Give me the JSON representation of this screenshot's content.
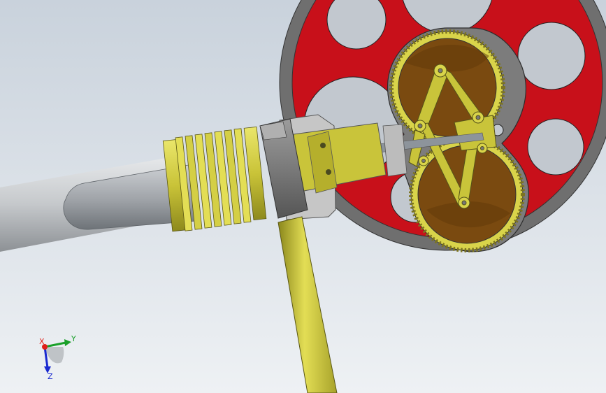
{
  "viewport": {
    "background_top": "#c9d2dc",
    "background_bottom": "#eef1f4"
  },
  "model": {
    "flywheel": {
      "rim_color": "#6f6f6f",
      "web_color": "#c8101a",
      "hole_color": "#c2c8cf"
    },
    "gearbox": {
      "housing_color": "#7c7c7c",
      "gear_color": "#d9d44a",
      "plate_color": "#7a4a10",
      "link_color": "#c9c43a"
    },
    "cylinder": {
      "fin_color": "#c8c23a",
      "body_color": "#a9a9a9",
      "piston_color": "#b8bcc1"
    },
    "rod": {
      "color": "#cfc73a"
    }
  },
  "triad": {
    "x_label": "X",
    "y_label": "Y",
    "z_label": "Z",
    "x_color": "#e0201a",
    "y_color": "#1aa02a",
    "z_color": "#1a2ad0"
  }
}
